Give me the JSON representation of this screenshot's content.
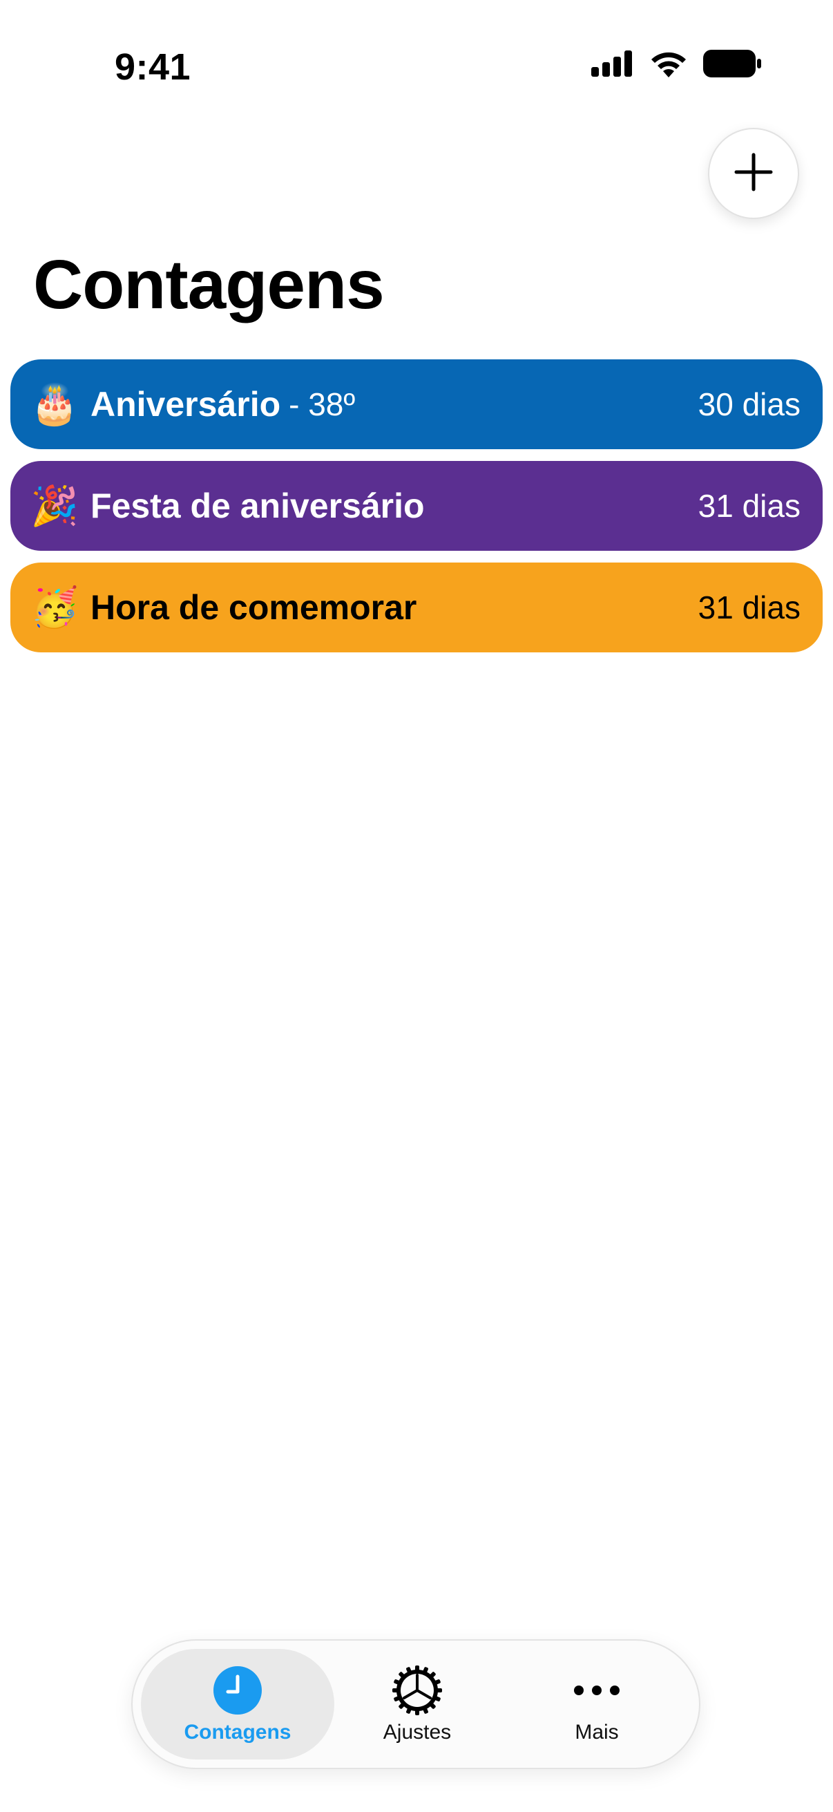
{
  "status_bar": {
    "time": "9:41"
  },
  "header": {
    "add_icon": "plus-icon",
    "title": "Contagens"
  },
  "counters": [
    {
      "emoji": "🎂",
      "name": "Aniversário",
      "suffix": "- 38º",
      "days": "30 dias",
      "color": "#0767b4",
      "text_color": "#ffffff"
    },
    {
      "emoji": "🎉",
      "name": "Festa de aniversário",
      "suffix": "",
      "days": "31 dias",
      "color": "#5b2f91",
      "text_color": "#ffffff"
    },
    {
      "emoji": "🥳",
      "name": "Hora de comemorar",
      "suffix": "",
      "days": "31 dias",
      "color": "#f7a31d",
      "text_color": "#000000"
    }
  ],
  "tab_bar": {
    "items": [
      {
        "label": "Contagens",
        "icon": "clock-icon",
        "active": true
      },
      {
        "label": "Ajustes",
        "icon": "gear-icon",
        "active": false
      },
      {
        "label": "Mais",
        "icon": "ellipsis-icon",
        "active": false
      }
    ],
    "active_color": "#1a9bf0"
  }
}
